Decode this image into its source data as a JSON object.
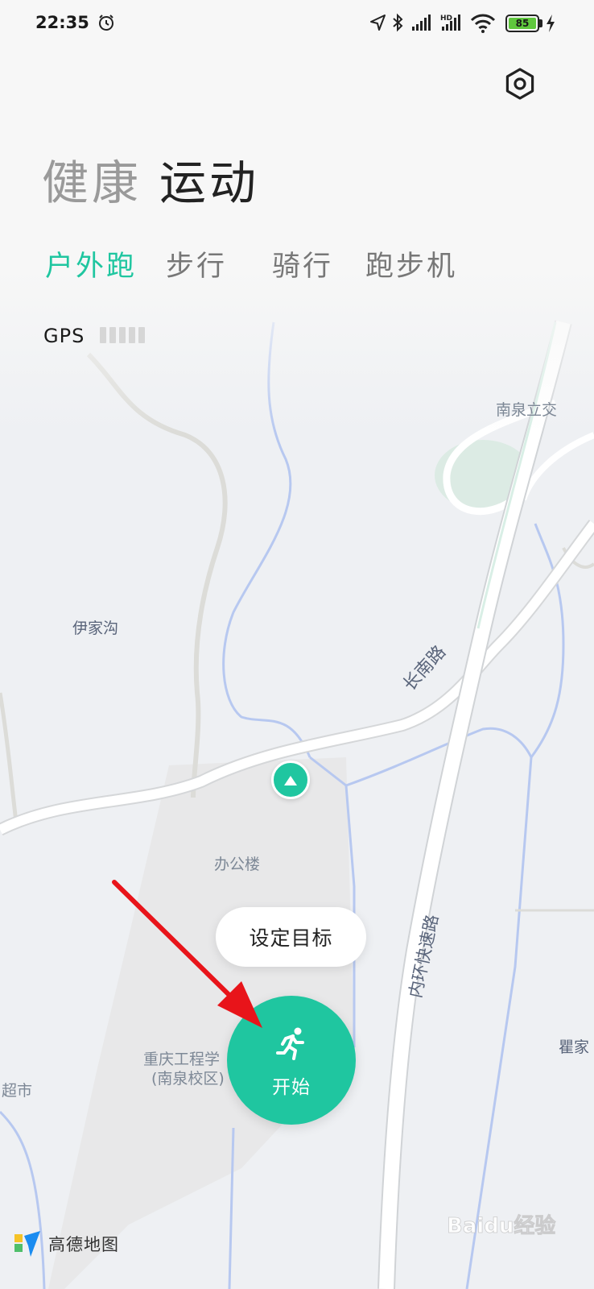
{
  "status_bar": {
    "time": "22:35",
    "battery_level": "85",
    "icons": [
      "alarm-icon",
      "location-arrow-icon",
      "bluetooth-icon",
      "signal-icon",
      "hd-signal-icon",
      "wifi-icon",
      "battery-icon",
      "charging-icon"
    ]
  },
  "header": {
    "settings_icon": "settings-hexagon-icon",
    "categories": [
      "健康",
      "运动"
    ],
    "active_category": "运动"
  },
  "sport_tabs": {
    "items": [
      "户外跑",
      "步行",
      "骑行",
      "跑步机"
    ],
    "active": "户外跑"
  },
  "gps": {
    "label": "GPS",
    "signal_bars_total": 5,
    "signal_bars_active": 0
  },
  "map": {
    "labels": {
      "nanquan_interchange": "南泉立交",
      "yijiagou": "伊家沟",
      "changnan_road": "长南路",
      "office_building": "办公楼",
      "inner_ring_expressway": "内环快速路",
      "college_line1": "重庆工程学",
      "college_line2": "(南泉校区)",
      "supermarket": "超市",
      "qu_jia": "瞿家"
    },
    "provider": "高德地图"
  },
  "controls": {
    "set_goal": "设定目标",
    "start": "开始"
  },
  "watermark": "Baidu经验",
  "colors": {
    "accent": "#1fc6a0",
    "annotation_arrow": "#e8141a"
  }
}
